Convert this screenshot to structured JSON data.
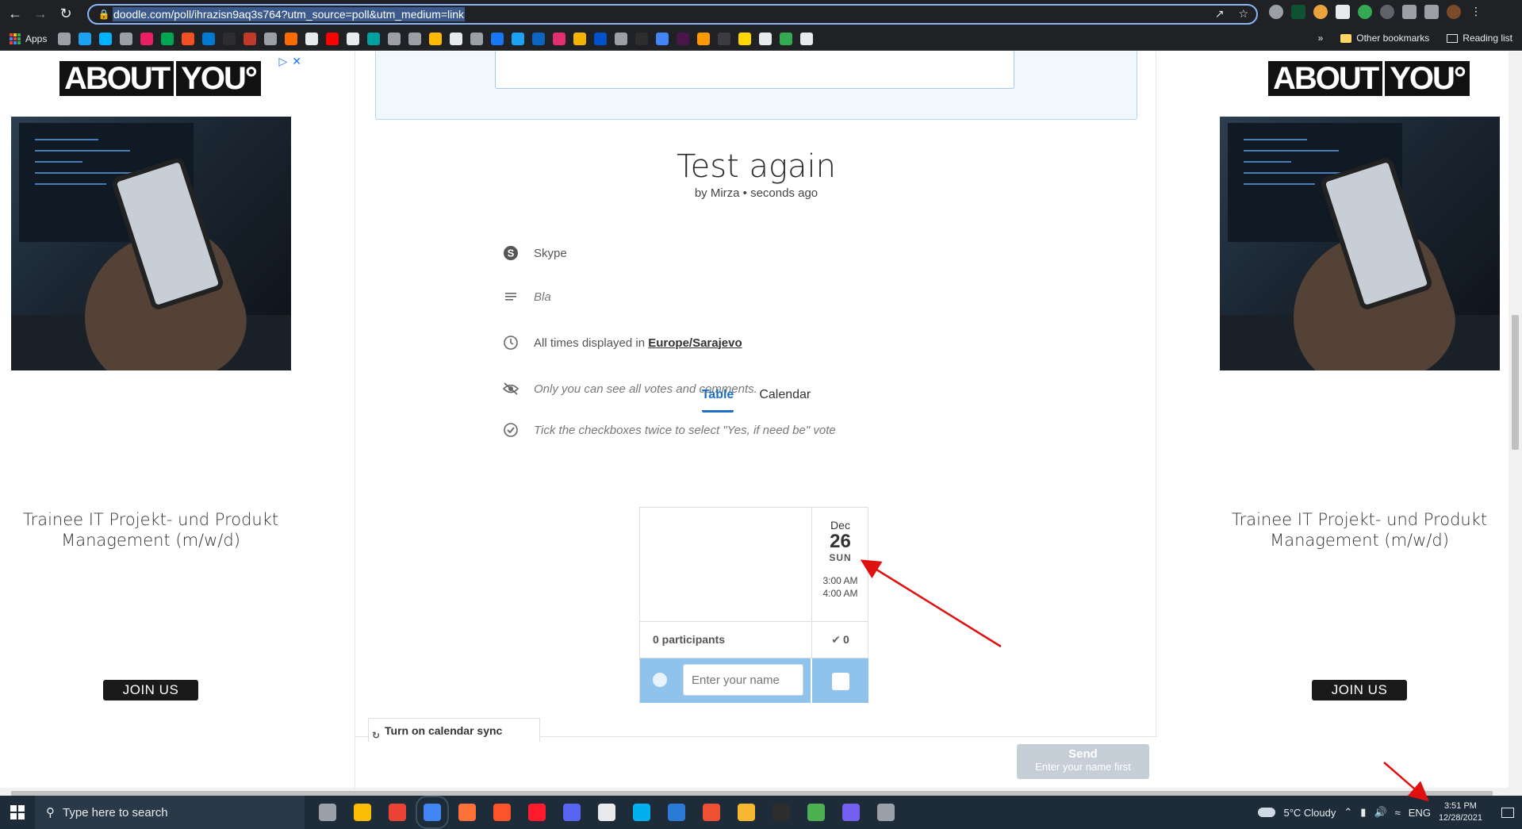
{
  "browser": {
    "url": "doodle.com/poll/ihrazisn9aq3s764?utm_source=poll&utm_medium=link",
    "bookmarks_apps_label": "Apps",
    "other_bookmarks_label": "Other bookmarks",
    "reading_list_label": "Reading list"
  },
  "ads": {
    "brand_part1": "ABOUT",
    "brand_part2": "YOU°",
    "headline": "Trainee IT Projekt- und Produkt Management (m/w/d)",
    "cta": "JOIN US"
  },
  "poll": {
    "title": "Test again",
    "byline": "by Mirza • seconds ago",
    "location": "Skype",
    "description": "Bla",
    "timezone_prefix": "All times displayed in",
    "timezone": "Europe/Sarajevo",
    "privacy_note": "Only you can see all votes and comments.",
    "tick_note": "Tick the checkboxes twice to select \"Yes, if need be\" vote",
    "tabs": [
      {
        "label": "Table",
        "active": true
      },
      {
        "label": "Calendar",
        "active": false
      }
    ],
    "option": {
      "month": "Dec",
      "day": "26",
      "weekday": "SUN",
      "start": "3:00 AM",
      "end": "4:00 AM",
      "yes_count": "0"
    },
    "participants": "0 participants",
    "name_placeholder": "Enter your name",
    "calendar_sync": "Turn on calendar sync",
    "send_label": "Send",
    "send_hint": "Enter your name first"
  },
  "taskbar": {
    "search_placeholder": "Type here to search",
    "weather": "5°C  Cloudy",
    "language": "ENG",
    "time": "3:51 PM",
    "date": "12/28/2021"
  },
  "colors": {
    "accent": "#1f6fc5",
    "input_row": "#8fc3ec",
    "annotation_arrow": "#e01010"
  }
}
